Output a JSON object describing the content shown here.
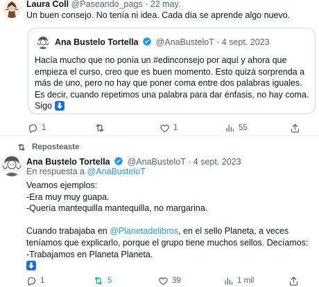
{
  "colors": {
    "accent": "#1d9bf0",
    "secondary_text": "#536471",
    "repost_active": "#00ba7c",
    "border": "#cfd9de"
  },
  "icons": {
    "reply": "speech-bubble-icon",
    "repost": "repost-arrows-icon",
    "like": "heart-icon",
    "views": "bar-chart-icon",
    "share": "share-icon",
    "verified": "verified-badge-icon",
    "arrow_down": "down-arrow-emoji-icon"
  },
  "tweet1": {
    "author_name": "Laura Coll",
    "handle": "@Paseando_pags",
    "separator": "·",
    "date": "22 may.",
    "text": "Un buen consejo. No tenía ni idea. Cada día se aprende algo nuevo.",
    "quote": {
      "author_name": "Ana Bustelo Tortella",
      "handle": "@AnaBusteloT",
      "separator": "·",
      "date": "4 sept. 2023",
      "text_before": "Hacía mucho que no ponía un #edinconsejo por aquí y ahora que empieza el curso, creo que es buen momento. Esto quizá sorprenda a más de uno, pero no hay que poner coma entre dos palabras iguales. Es decir, cuando repetimos una palabra para dar énfasis, no hay coma.\nSigo"
    },
    "actions": {
      "replies": "1",
      "reposts": "",
      "likes": "1",
      "views": "55"
    }
  },
  "tweet2": {
    "reposted_label": "Reposteaste",
    "author_name": "Ana Bustelo Tortella",
    "handle": "@AnaBusteloT",
    "separator": "·",
    "date": "4 sept. 2023",
    "in_reply_prefix": "En respuesta a ",
    "in_reply_handle": "@AnaBusteloT",
    "text_part1": "Veamos ejemplos:\n-Era muy muy guapa.\n-Quería mantequilla mantequilla, no margarina.\n\nCuando trabajaba en ",
    "text_link": "@Planetadelibros",
    "text_part2": ", en el sello Planeta, a veces teníamos que explicarlo, porque el grupo tiene muchos sellos. Decíamos:\n-Trabajamos en Planeta Planeta.",
    "actions": {
      "replies": "1",
      "reposts": "5",
      "likes": "39",
      "views": "1 mil"
    }
  }
}
